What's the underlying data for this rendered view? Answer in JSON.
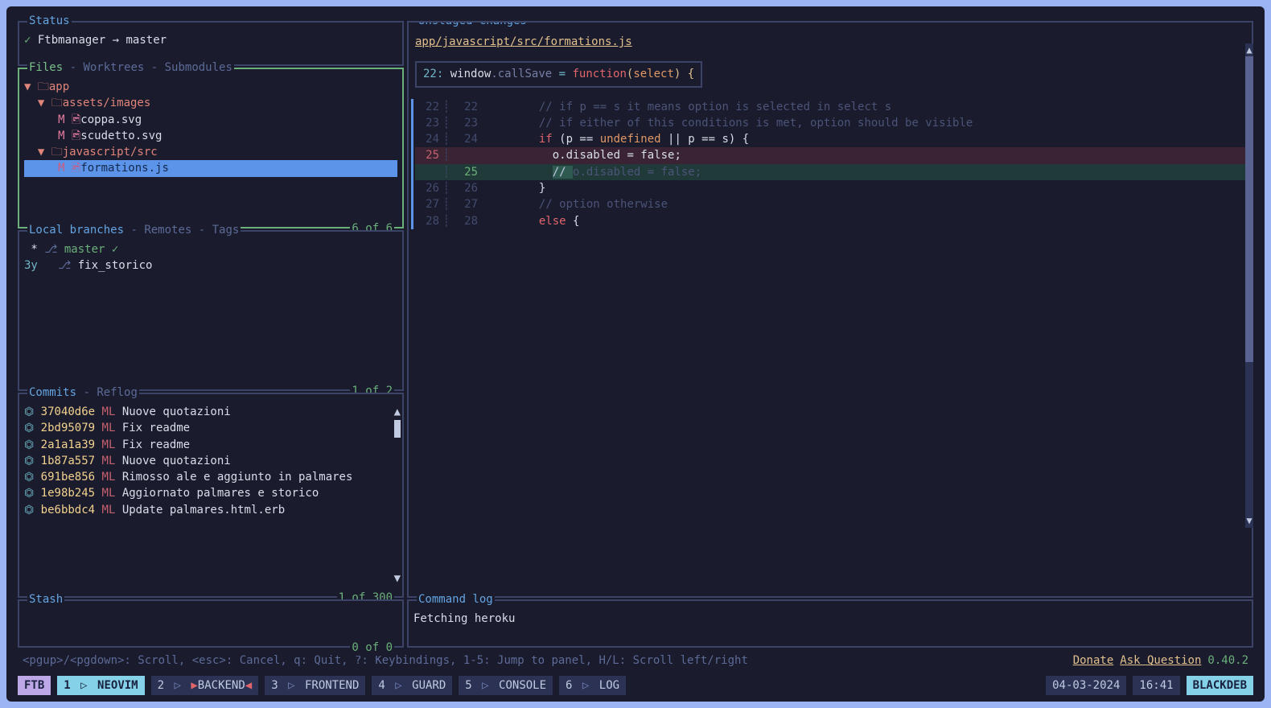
{
  "status": {
    "title": "Status",
    "repo": "Ftbmanager",
    "arrow": "→",
    "branch": "master",
    "check": "✓"
  },
  "files": {
    "tabs": [
      "Files",
      "Worktrees",
      "Submodules"
    ],
    "active_tab": 0,
    "tree": {
      "app_label": "app",
      "assets_label": "assets/images",
      "file1": "coppa.svg",
      "file2": "scudetto.svg",
      "js_label": "javascript/src",
      "file3": "formations.js",
      "mod_marker": "M"
    },
    "footer": "6 of 6"
  },
  "branches": {
    "tabs": [
      "Local branches",
      "Remotes",
      "Tags"
    ],
    "active_tab": 0,
    "items": [
      {
        "prefix": " * ",
        "icon": "⎌",
        "name": "master",
        "check": "✓",
        "age": ""
      },
      {
        "prefix": "",
        "icon": "⎌",
        "name": "fix_storico",
        "check": "",
        "age": "3y"
      }
    ],
    "footer": "1 of 2"
  },
  "commits": {
    "tabs": [
      "Commits",
      "Reflog"
    ],
    "active_tab": 0,
    "items": [
      {
        "hash": "37040d6e",
        "author": "ML",
        "msg": "Nuove quotazioni"
      },
      {
        "hash": "2bd95079",
        "author": "ML",
        "msg": "Fix readme"
      },
      {
        "hash": "2a1a1a39",
        "author": "ML",
        "msg": "Fix readme"
      },
      {
        "hash": "1b87a557",
        "author": "ML",
        "msg": "Nuove quotazioni"
      },
      {
        "hash": "691be856",
        "author": "ML",
        "msg": "Rimosso ale e aggiunto in palmares"
      },
      {
        "hash": "1e98b245",
        "author": "ML",
        "msg": "Aggiornato palmares e storico"
      },
      {
        "hash": "be6bbdc4",
        "author": "ML",
        "msg": "Update palmares.html.erb"
      }
    ],
    "footer": "1 of 300"
  },
  "stash": {
    "title": "Stash",
    "footer": "0 of 0"
  },
  "diff": {
    "title": "Unstaged changes",
    "filepath": "app/javascript/src/formations.js",
    "func": {
      "ln": "22:",
      "p0": "window",
      "p1": ".callSave ",
      "eq": "= ",
      "fn": "function",
      "open": "(",
      "arg": "select",
      "close": ") {"
    },
    "lines": {
      "c22": "    // if p == s it means option is selected in select s",
      "c23": "    // if either of this conditions is met, option should be visible",
      "c24_if": "if",
      "c24_rest": " (p == ",
      "c24_undef": "undefined",
      "c24_rest2": " || p == s) {",
      "c25_removed": "      o.disabled = false;",
      "c25_added_pre": "// ",
      "c25_added_body": "o.disabled = false;",
      "c26": "    }",
      "c27": "    // option otherwise",
      "c28_else": "else",
      "c28_rest": " {"
    }
  },
  "cmdlog": {
    "title": "Command log",
    "text": "Fetching heroku"
  },
  "help": {
    "text": "<pgup>/<pgdown>: Scroll, <esc>: Cancel, q: Quit, ?: Keybindings, 1-5: Jump to panel, H/L: Scroll left/right",
    "donate": "Donate",
    "ask": "Ask Question",
    "version": "0.40.2"
  },
  "statusbar": {
    "ftb": "FTB",
    "tabs": [
      {
        "n": "1",
        "label": "NEOVIM"
      },
      {
        "n": "2",
        "label": "BACKEND",
        "highlight": true
      },
      {
        "n": "3",
        "label": "FRONTEND"
      },
      {
        "n": "4",
        "label": "GUARD"
      },
      {
        "n": "5",
        "label": "CONSOLE"
      },
      {
        "n": "6",
        "label": "LOG"
      }
    ],
    "date": "04-03-2024",
    "time": "16:41",
    "host": "BLACKDEB"
  }
}
